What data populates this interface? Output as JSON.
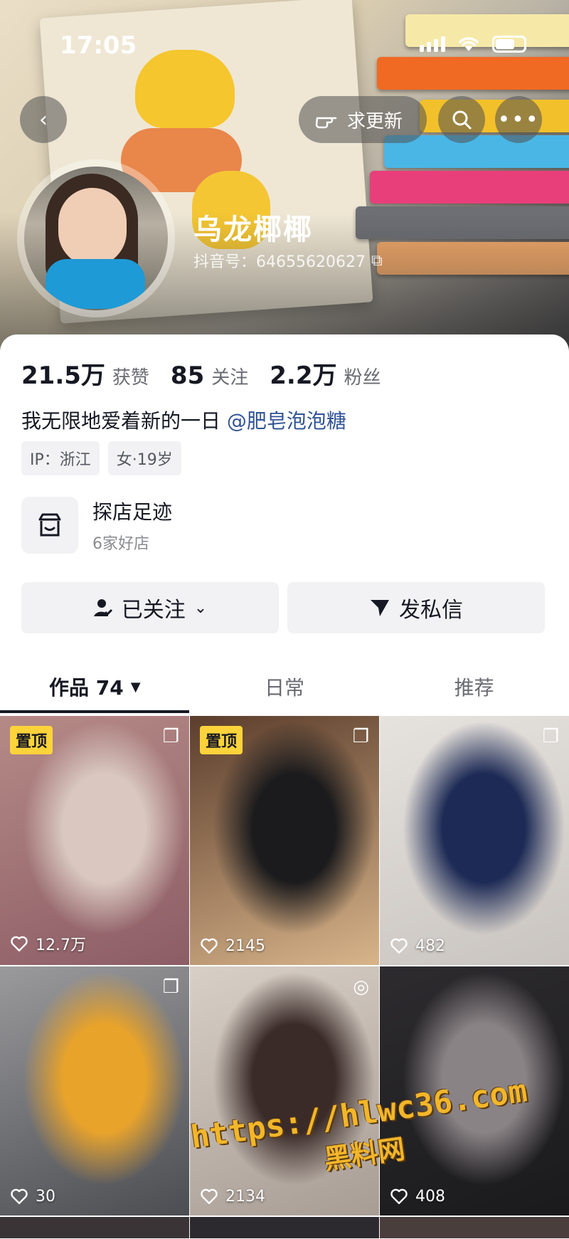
{
  "status": {
    "time": "17:05"
  },
  "header": {
    "request_update_label": "求更新",
    "nickname": "乌龙椰椰",
    "douyin_id": "抖音号：64655620627"
  },
  "stats": [
    {
      "num": "21.5万",
      "label": "获赞"
    },
    {
      "num": "85",
      "label": "关注"
    },
    {
      "num": "2.2万",
      "label": "粉丝"
    }
  ],
  "bio": {
    "text": "我无限地爱着新的一日",
    "mention": "@肥皂泡泡糖"
  },
  "tags": [
    "IP：浙江",
    "女·19岁"
  ],
  "shop": {
    "title": "探店足迹",
    "subtitle": "6家好店"
  },
  "actions": {
    "follow_label": "已关注",
    "message_label": "发私信"
  },
  "tabs": [
    {
      "label": "作品 74"
    },
    {
      "label": "日常"
    },
    {
      "label": "推荐"
    }
  ],
  "videos": [
    {
      "likes": "12.7万",
      "pinned": "置顶",
      "type": "album",
      "colors": [
        "#b58a86",
        "#d9c7c0",
        "#8c5d66"
      ]
    },
    {
      "likes": "2145",
      "pinned": "置顶",
      "type": "album",
      "colors": [
        "#5b3d2c",
        "#1b1b1d",
        "#d8b48a"
      ]
    },
    {
      "likes": "482",
      "pinned": "",
      "type": "album",
      "colors": [
        "#e6e2de",
        "#1d2a55",
        "#c9c4bf"
      ]
    },
    {
      "likes": "30",
      "pinned": "",
      "type": "album",
      "colors": [
        "#9a9a9c",
        "#e8a32b",
        "#4c4d52"
      ]
    },
    {
      "likes": "2134",
      "pinned": "",
      "type": "live",
      "colors": [
        "#d8cfc6",
        "#3a2b28",
        "#a89d95"
      ]
    },
    {
      "likes": "408",
      "pinned": "",
      "type": "",
      "colors": [
        "#2d2b2e",
        "#8a8386",
        "#1a1a1c"
      ]
    }
  ],
  "watermark": {
    "url": "https://hlwc36.com",
    "name": "黑料网"
  }
}
